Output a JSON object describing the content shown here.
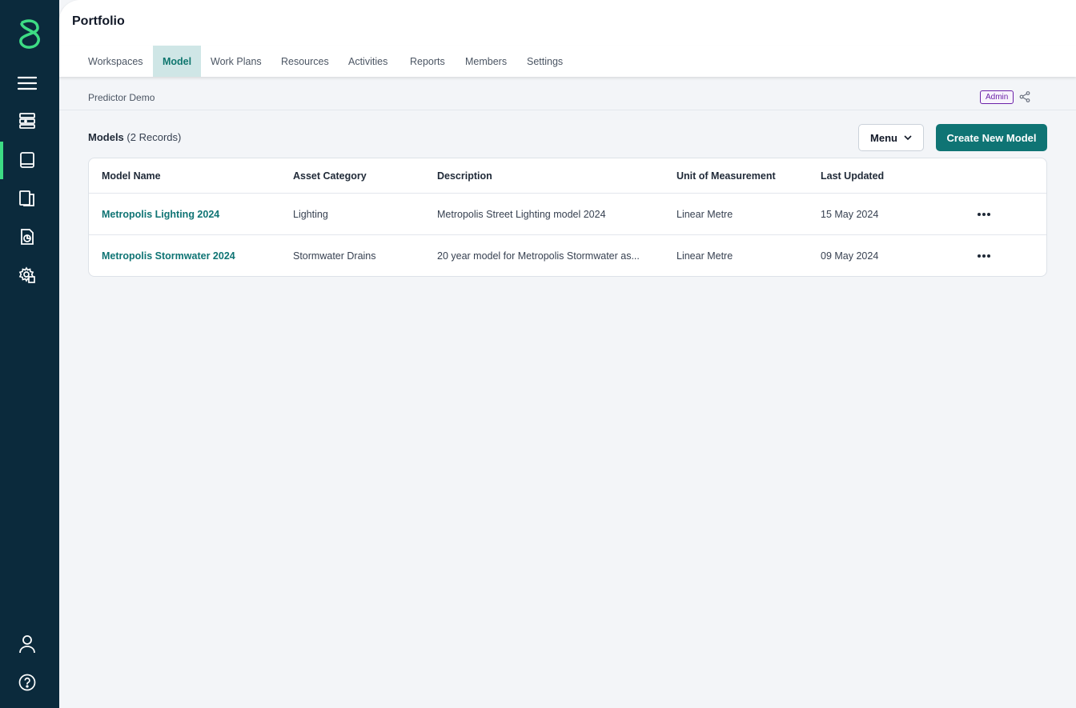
{
  "colors": {
    "sidebar": "#0b2a3c",
    "accent": "#0f7474",
    "active_indicator": "#3ddc84",
    "admin_badge": "#6b21a8"
  },
  "sidebar": {
    "icons": [
      "menu-icon",
      "database-icon",
      "book-icon",
      "documents-icon",
      "report-icon",
      "settings-icon",
      "user-icon",
      "help-icon"
    ]
  },
  "header": {
    "title": "Portfolio"
  },
  "tabs": [
    {
      "label": "Workspaces"
    },
    {
      "label": "Model"
    },
    {
      "label": "Work Plans"
    },
    {
      "label": "Resources"
    },
    {
      "label": "Activities"
    },
    {
      "label": "Reports"
    },
    {
      "label": "Members"
    },
    {
      "label": "Settings"
    }
  ],
  "breadcrumb": {
    "label": "Predictor Demo",
    "role_badge": "Admin"
  },
  "section": {
    "title": "Models",
    "count": "(2 Records)",
    "menu_label": "Menu",
    "create_label": "Create New Model"
  },
  "table": {
    "columns": [
      "Model Name",
      "Asset Category",
      "Description",
      "Unit of Measurement",
      "Last Updated"
    ],
    "rows": [
      {
        "name": "Metropolis Lighting 2024",
        "category": "Lighting",
        "description": "Metropolis Street Lighting model 2024",
        "unit": "Linear Metre",
        "updated": "15 May 2024"
      },
      {
        "name": "Metropolis Stormwater 2024",
        "category": "Stormwater Drains",
        "description": "20 year model for Metropolis Stormwater as...",
        "unit": "Linear Metre",
        "updated": "09 May 2024"
      }
    ]
  }
}
